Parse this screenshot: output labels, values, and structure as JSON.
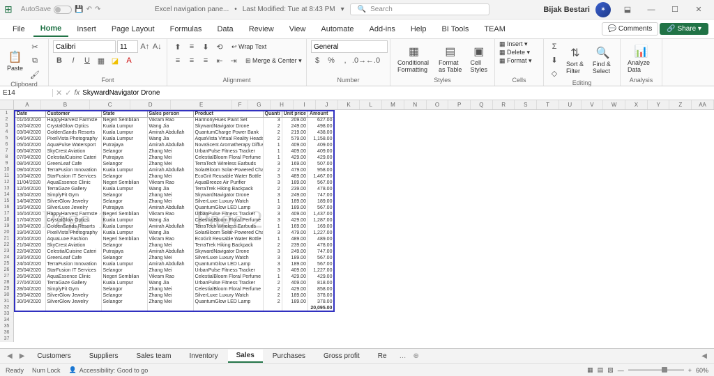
{
  "titlebar": {
    "autosave": "AutoSave",
    "filename": "Excel navigation pane...",
    "modified": "Last Modified: Tue at 8:43 PM",
    "search": "Search",
    "user": "Bijak Bestari"
  },
  "menu": {
    "file": "File",
    "home": "Home",
    "insert": "Insert",
    "pagelayout": "Page Layout",
    "formulas": "Formulas",
    "data": "Data",
    "review": "Review",
    "view": "View",
    "automate": "Automate",
    "addins": "Add-ins",
    "help": "Help",
    "bi": "BI Tools",
    "team": "TEAM",
    "comments": "Comments",
    "share": "Share"
  },
  "ribbon": {
    "paste": "Paste",
    "clipboard": "Clipboard",
    "font_name": "Calibri",
    "font_size": "11",
    "font": "Font",
    "wrap": "Wrap Text",
    "merge": "Merge & Center",
    "alignment": "Alignment",
    "numfmt": "General",
    "number": "Number",
    "condfmt": "Conditional Formatting",
    "fmttbl": "Format as Table",
    "cellstyles": "Cell Styles",
    "styles": "Styles",
    "insert": "Insert",
    "delete": "Delete",
    "format": "Format",
    "cells": "Cells",
    "sort": "Sort & Filter",
    "find": "Find & Select",
    "editing": "Editing",
    "analyze": "Analyze Data",
    "analysis": "Analysis"
  },
  "namebox": "E14",
  "formula": "SkywardNavigator Drone",
  "cols": [
    "A",
    "B",
    "C",
    "D",
    "E",
    "F",
    "G",
    "H",
    "I",
    "J",
    "K",
    "L",
    "M",
    "N",
    "O",
    "P",
    "Q",
    "R",
    "S",
    "T",
    "U",
    "V",
    "W",
    "X",
    "Y",
    "Z",
    "AA"
  ],
  "headers": [
    "Date",
    "Customer",
    "State",
    "Sales person",
    "Product",
    "Quanti",
    "Unit price",
    "Amount"
  ],
  "rows": [
    [
      "01/04/2020",
      "HappyHarvest Farmste",
      "Negeri Sembilan",
      "Vikram Rao",
      "HarmonyHues Paint Set",
      "3",
      "209.00",
      "627.00"
    ],
    [
      "02/04/2020",
      "CrystalGlow Optics",
      "Kuala Lumpur",
      "Wang Jia",
      "SkywardNavigator Drone",
      "2",
      "249.00",
      "498.00"
    ],
    [
      "03/04/2020",
      "GoldenSands Resorts",
      "Kuala Lumpur",
      "Amirah Abdullah",
      "QuantumCharge Power Bank",
      "2",
      "219.00",
      "438.00"
    ],
    [
      "04/04/2020",
      "PixelVista Photography",
      "Kuala Lumpur",
      "Wang Jia",
      "AquaVista Virtual Reality Headse",
      "2",
      "579.00",
      "1,158.00"
    ],
    [
      "05/04/2020",
      "AquaPulse Watersport",
      "Putrajaya",
      "Amirah Abdullah",
      "NovaScent Aromatherapy Diffus",
      "1",
      "409.00",
      "409.00"
    ],
    [
      "06/04/2020",
      "SkyCrest Aviation",
      "Selangor",
      "Zhang Mei",
      "UrbanPulse Fitness Tracker",
      "1",
      "409.00",
      "409.00"
    ],
    [
      "07/04/2020",
      "CelestialCuisine Cateri",
      "Putrajaya",
      "Zhang Mei",
      "CelestialBloom Floral Perfume",
      "1",
      "429.00",
      "429.00"
    ],
    [
      "08/04/2020",
      "GreenLeaf Cafe",
      "Selangor",
      "Zhang Mei",
      "TerraTech Wireless Earbuds",
      "3",
      "169.00",
      "507.00"
    ],
    [
      "09/04/2020",
      "TerraFusion Innovation",
      "Kuala Lumpur",
      "Amirah Abdullah",
      "SolarBloom Solar-Powered Cha",
      "2",
      "479.00",
      "958.00"
    ],
    [
      "10/04/2020",
      "StarFusion IT Services",
      "Selangor",
      "Zhang Mei",
      "EcoGrit Reusable Water Bottle",
      "3",
      "489.00",
      "1,467.00"
    ],
    [
      "11/04/2020",
      "AquaEssence Clinic",
      "Negeri Sembilan",
      "Vikram Rao",
      "AquaBreeze Air Purifier",
      "3",
      "189.00",
      "567.00"
    ],
    [
      "12/04/2020",
      "TerraGaze Gallery",
      "Kuala Lumpur",
      "Wang Jia",
      "TerraTrek Hiking Backpack",
      "2",
      "239.00",
      "478.00"
    ],
    [
      "13/04/2020",
      "SimplyFit Gym",
      "Selangor",
      "Zhang Mei",
      "SkywardNavigator Drone",
      "3",
      "249.00",
      "747.00"
    ],
    [
      "14/04/2020",
      "SilverGlow Jewelry",
      "Selangor",
      "Zhang Mei",
      "SilverLuxe Luxury Watch",
      "1",
      "189.00",
      "189.00"
    ],
    [
      "15/04/2020",
      "SilverLuxe Jewelry",
      "Putrajaya",
      "Amirah Abdullah",
      "QuantumGlow LED Lamp",
      "3",
      "189.00",
      "567.00"
    ],
    [
      "16/04/2020",
      "HappyHarvest Farmste",
      "Negeri Sembilan",
      "Vikram Rao",
      "UrbanPulse Fitness Tracker",
      "3",
      "409.00",
      "1,437.00"
    ],
    [
      "17/04/2020",
      "CrystalGlow Optics",
      "Kuala Lumpur",
      "Wang Jia",
      "CelestialBloom Floral Perfume",
      "3",
      "429.00",
      "1,287.00"
    ],
    [
      "18/04/2020",
      "GoldenSands Resorts",
      "Kuala Lumpur",
      "Amirah Abdullah",
      "TerraTech Wireless Earbuds",
      "1",
      "169.00",
      "169.00"
    ],
    [
      "19/04/2020",
      "PixelVista Photography",
      "Kuala Lumpur",
      "Wang Jia",
      "SolarBloom Solar-Powered Cha",
      "3",
      "479.00",
      "1,227.00"
    ],
    [
      "20/04/2020",
      "AquaLuxe Fashion",
      "Negeri Sembilan",
      "Vikram Rao",
      "EcoGrit Reusable Water Bottle",
      "1",
      "489.00",
      "489.00"
    ],
    [
      "21/04/2020",
      "SkyCrest Aviation",
      "Selangor",
      "Zhang Mei",
      "TerraTrek Hiking Backpack",
      "2",
      "239.00",
      "478.00"
    ],
    [
      "22/04/2020",
      "CelestialCuisine Cateri",
      "Putrajaya",
      "Amirah Abdullah",
      "SkywardNavigator Drone",
      "3",
      "249.00",
      "747.00"
    ],
    [
      "23/04/2020",
      "GreenLeaf Cafe",
      "Selangor",
      "Zhang Mei",
      "SilverLuxe Luxury Watch",
      "3",
      "189.00",
      "567.00"
    ],
    [
      "24/04/2020",
      "TerraFusion Innovation",
      "Kuala Lumpur",
      "Amirah Abdullah",
      "QuantumGlow LED Lamp",
      "3",
      "189.00",
      "567.00"
    ],
    [
      "25/04/2020",
      "StarFusion IT Services",
      "Selangor",
      "Zhang Mei",
      "UrbanPulse Fitness Tracker",
      "3",
      "409.00",
      "1,227.00"
    ],
    [
      "26/04/2020",
      "AquaEssence Clinic",
      "Negeri Sembilan",
      "Vikram Rao",
      "CelestialBloom Floral Perfume",
      "1",
      "429.00",
      "429.00"
    ],
    [
      "27/04/2020",
      "TerraGaze Gallery",
      "Kuala Lumpur",
      "Wang Jia",
      "UrbanPulse Fitness Tracker",
      "2",
      "409.00",
      "818.00"
    ],
    [
      "28/04/2020",
      "SimplyFit Gym",
      "Selangor",
      "Zhang Mei",
      "CelestialBloom Floral Perfume",
      "2",
      "429.00",
      "858.00"
    ],
    [
      "29/04/2020",
      "SilverGlow Jewelry",
      "Selangor",
      "Zhang Mei",
      "SilverLuxe Luxury Watch",
      "2",
      "189.00",
      "378.00"
    ],
    [
      "30/04/2020",
      "SilverGlow Jewelry",
      "Selangor",
      "Zhang Mei",
      "QuantumGlow LED Lamp",
      "2",
      "189.00",
      "378.00"
    ]
  ],
  "total": "20,095.00",
  "watermark1": "Page 1",
  "watermark2": "Page 2",
  "tabs": {
    "customers": "Customers",
    "suppliers": "Suppliers",
    "salesteam": "Sales team",
    "inventory": "Inventory",
    "sales": "Sales",
    "purchases": "Purchases",
    "gross": "Gross profit",
    "re": "Re"
  },
  "status": {
    "ready": "Ready",
    "numlock": "Num Lock",
    "access": "Accessibility: Good to go",
    "zoom": "60%"
  }
}
